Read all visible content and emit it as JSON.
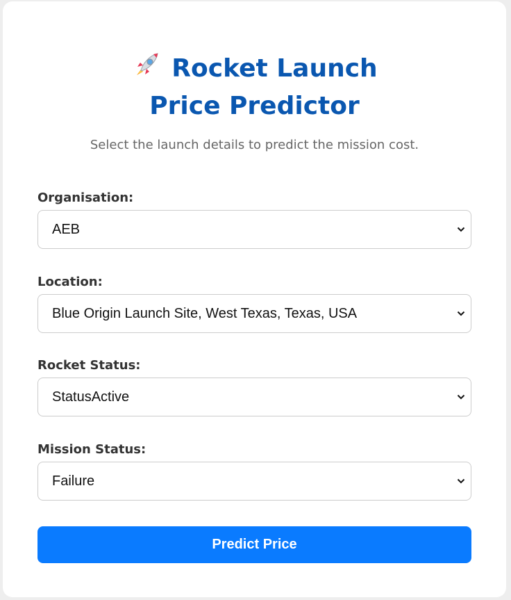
{
  "header": {
    "title": "Rocket Launch Price Predictor",
    "icon": "rocket-icon",
    "subtitle": "Select the launch details to predict the mission cost."
  },
  "form": {
    "organisation": {
      "label": "Organisation:",
      "value": "AEB"
    },
    "location": {
      "label": "Location:",
      "value": "Blue Origin Launch Site, West Texas, Texas, USA"
    },
    "rocket_status": {
      "label": "Rocket Status:",
      "value": "StatusActive"
    },
    "mission_status": {
      "label": "Mission Status:",
      "value": "Failure"
    },
    "submit_label": "Predict Price"
  },
  "colors": {
    "title": "#0a57b0",
    "button": "#0a7bff",
    "background": "#eeeeee",
    "card": "#ffffff"
  }
}
